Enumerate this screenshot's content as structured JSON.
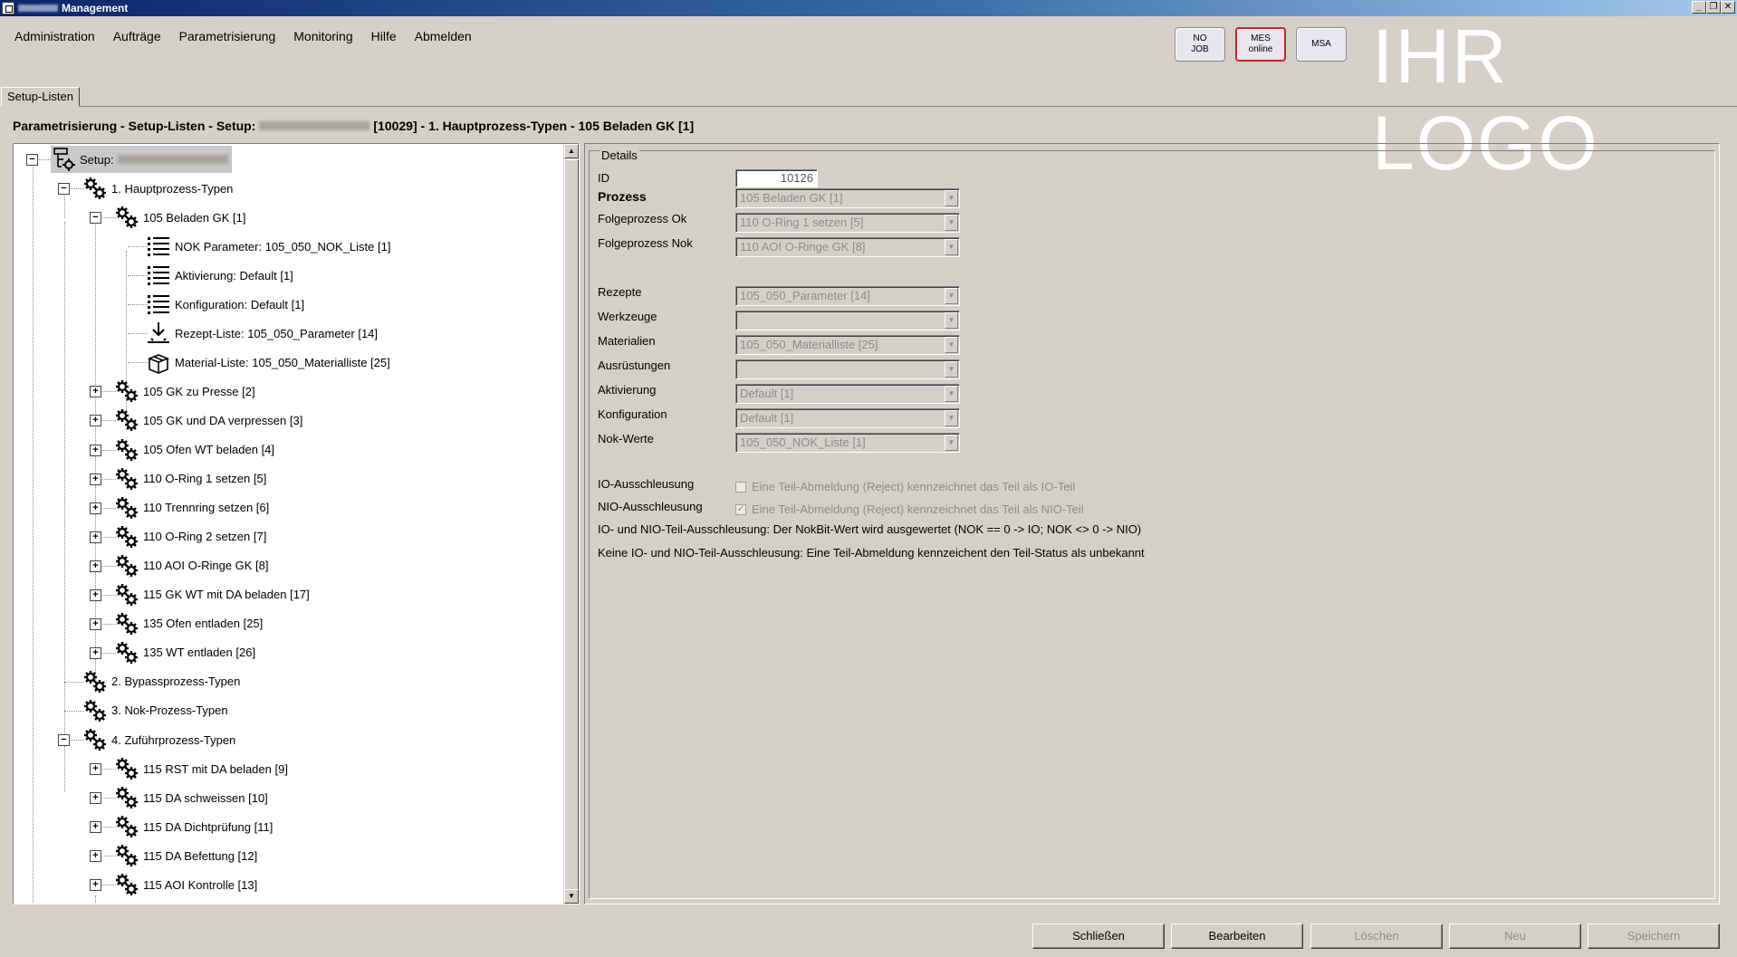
{
  "window": {
    "title": "Management",
    "controls": [
      "_",
      "❐",
      "✕"
    ]
  },
  "menu": [
    "Administration",
    "Aufträge",
    "Parametrisierung",
    "Monitoring",
    "Hilfe",
    "Abmelden"
  ],
  "status_buttons": {
    "no_job": "NO JOB",
    "mes_online": "MES online",
    "msa": "MSA"
  },
  "logo_text": "IHR LOGO",
  "tab": "Setup-Listen",
  "breadcrumb": {
    "prefix": "Parametrisierung - Setup-Listen - Setup:",
    "suffix": "[10029] - 1. Hauptprozess-Typen - 105 Beladen GK [1]"
  },
  "tree": {
    "root_label": "Setup:",
    "nodes": [
      {
        "label": "1. Hauptprozess-Typen"
      },
      {
        "label": "105 Beladen GK [1]"
      },
      {
        "label": "NOK Parameter: 105_050_NOK_Liste [1]"
      },
      {
        "label": "Aktivierung: Default [1]"
      },
      {
        "label": "Konfiguration: Default [1]"
      },
      {
        "label": "Rezept-Liste: 105_050_Parameter [14]"
      },
      {
        "label": "Material-Liste: 105_050_Materialliste [25]"
      },
      {
        "label": "105 GK zu Presse [2]"
      },
      {
        "label": "105 GK und DA verpressen [3]"
      },
      {
        "label": "105 Ofen WT beladen [4]"
      },
      {
        "label": "110 O-Ring 1 setzen [5]"
      },
      {
        "label": "110 Trennring setzen [6]"
      },
      {
        "label": "110 O-Ring 2 setzen [7]"
      },
      {
        "label": "110 AOI O-Ringe GK [8]"
      },
      {
        "label": "115 GK WT mit DA beladen [17]"
      },
      {
        "label": "135 Ofen entladen [25]"
      },
      {
        "label": "135 WT entladen [26]"
      },
      {
        "label": "2. Bypassprozess-Typen"
      },
      {
        "label": "3. Nok-Prozess-Typen"
      },
      {
        "label": "4. Zuführprozess-Typen"
      },
      {
        "label": "115 RST mit DA beladen [9]"
      },
      {
        "label": "115 DA schweissen [10]"
      },
      {
        "label": "115 DA Dichtprüfung [11]"
      },
      {
        "label": "115 DA Befettung [12]"
      },
      {
        "label": "115 AOI Kontrolle [13]"
      }
    ]
  },
  "details": {
    "group_title": "Details",
    "id_label": "ID",
    "id_value": "10126",
    "prozess_label": "Prozess",
    "prozess_value": "105 Beladen GK [1]",
    "folge_ok_label": "Folgeprozess Ok",
    "folge_ok_value": "110 O-Ring 1 setzen [5]",
    "folge_nok_label": "Folgeprozess Nok",
    "folge_nok_value": "110 AOI O-Ringe GK [8]",
    "rezepte_label": "Rezepte",
    "rezepte_value": "105_050_Parameter [14]",
    "werkzeuge_label": "Werkzeuge",
    "werkzeuge_value": "",
    "materialien_label": "Materialien",
    "materialien_value": "105_050_Materialliste [25]",
    "ausruestungen_label": "Ausrüstungen",
    "ausruestungen_value": "",
    "aktivierung_label": "Aktivierung",
    "aktivierung_value": "Default [1]",
    "konfiguration_label": "Konfiguration",
    "konfiguration_value": "Default [1]",
    "nok_werte_label": "Nok-Werte",
    "nok_werte_value": "105_050_NOK_Liste [1]",
    "io_label": "IO-Ausschleusung",
    "io_checkbox_text": "Eine Teil-Abmeldung (Reject) kennzeichnet das Teil als IO-Teil",
    "io_checked": false,
    "nio_label": "NIO-Ausschleusung",
    "nio_checkbox_text": "Eine Teil-Abmeldung (Reject) kennzeichnet das Teil als NIO-Teil",
    "nio_checked": true,
    "info1": "IO- und NIO-Teil-Ausschleusung: Der NokBit-Wert wird ausgewertet (NOK ==  0 -> IO; NOK <> 0 -> NIO)",
    "info2": "Keine IO- und NIO-Teil-Ausschleusung:  Eine Teil-Abmeldung kennzeichent den Teil-Status als unbekannt"
  },
  "buttons": {
    "schliessen": "Schließen",
    "bearbeiten": "Bearbeiten",
    "loeschen": "Löschen",
    "neu": "Neu",
    "speichern": "Speichern"
  }
}
